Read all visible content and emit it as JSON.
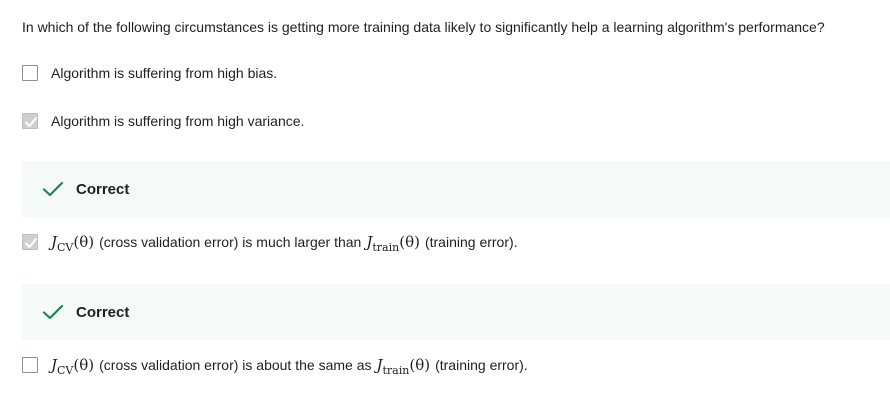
{
  "question": {
    "text": "In which of the following circumstances is getting more training data likely to significantly help a learning algorithm's performance?"
  },
  "options": [
    {
      "label": "Algorithm is suffering from high bias.",
      "checked": false
    },
    {
      "label": "Algorithm is suffering from high variance.",
      "checked": true
    },
    {
      "checked": true,
      "math1": "J",
      "sub1": "CV",
      "arg1": "(θ)",
      "text1": "(cross validation error) is much larger than",
      "math2": "J",
      "sub2": "train",
      "arg2": "(θ)",
      "text2": "(training error)."
    },
    {
      "checked": false,
      "math1": "J",
      "sub1": "CV",
      "arg1": "(θ)",
      "text1": "(cross validation error) is about the same as",
      "math2": "J",
      "sub2": "train",
      "arg2": "(θ)",
      "text2": "(training error)."
    }
  ],
  "feedback": [
    {
      "label": "Correct",
      "status_color": "#1f8354",
      "icon": "checkmark-icon"
    },
    {
      "label": "Correct",
      "status_color": "#1f8354",
      "icon": "checkmark-icon"
    }
  ]
}
